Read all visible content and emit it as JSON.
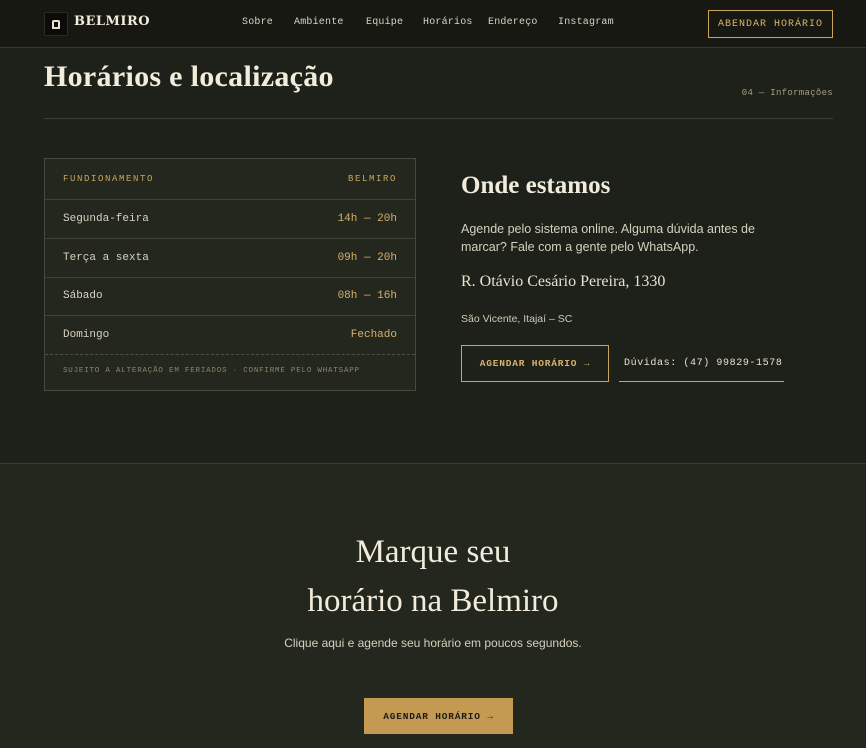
{
  "nav": {
    "brand": "BELMIRO",
    "links": [
      "Sobre",
      "Ambiente",
      "Equipe",
      "Horários",
      "Endereço",
      "Instagram"
    ],
    "cta": "ABENDAR HORÁRIO"
  },
  "section": {
    "title": "Horários e localização",
    "tag": "04 — Informações"
  },
  "hours": {
    "header_left": "FUNDIONAMENTO",
    "header_right": "BELMIRO",
    "rows": [
      {
        "day": "Segunda-feira",
        "time": "14h — 20h"
      },
      {
        "day": "Terça a sexta",
        "time": "09h — 20h"
      },
      {
        "day": "Sábado",
        "time": "08h — 16h"
      },
      {
        "day": "Domingo",
        "time": "Fechado"
      }
    ],
    "note": "SUJEITO A ALTERAÇÃO EM FERIADOS · CONFIRME PELO WHATSAPP"
  },
  "where": {
    "title": "Onde estamos",
    "description": "Agende pelo sistema online. Alguma dúvida antes de marcar? Fale com a gente pelo WhatsApp.",
    "address": "R. Otávio Cesário Pereira, 1330",
    "city": "São Vicente, Itajaí – SC",
    "book_button": "AGENDAR HORÁRIO →",
    "phone_button": "Dúvidas: (47) 99829-1578"
  },
  "cta": {
    "title_line1": "Marque seu",
    "title_line2": "horário na Belmiro",
    "subtitle": "Clique aqui e agende seu horário em poucos segundos.",
    "button": "AGENDAR HORÁRIO →"
  },
  "colors": {
    "background": "#1d2119",
    "panel": "#23271e",
    "accent": "#c8a55a",
    "text": "#e8e2cf"
  }
}
